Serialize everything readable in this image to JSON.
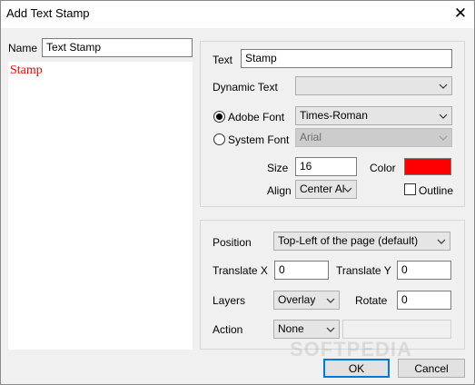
{
  "window": {
    "title": "Add Text Stamp"
  },
  "left": {
    "name_label": "Name",
    "name_value": "Text Stamp",
    "preview_text": "Stamp"
  },
  "text_group": {
    "text_label": "Text",
    "text_value": "Stamp",
    "dynamic_text_label": "Dynamic Text",
    "dynamic_text_value": "",
    "adobe_font_label": "Adobe Font",
    "adobe_font_value": "Times-Roman",
    "system_font_label": "System Font",
    "system_font_value": "Arial",
    "font_mode": "adobe",
    "size_label": "Size",
    "size_value": "16",
    "color_label": "Color",
    "color_value": "#ff0000",
    "align_label": "Align",
    "align_value": "Center Al",
    "outline_label": "Outline",
    "outline_checked": false
  },
  "position_group": {
    "position_label": "Position",
    "position_value": "Top-Left of the page (default)",
    "translate_x_label": "Translate X",
    "translate_x_value": "0",
    "translate_y_label": "Translate Y",
    "translate_y_value": "0",
    "layers_label": "Layers",
    "layers_value": "Overlay",
    "rotate_label": "Rotate",
    "rotate_value": "0",
    "action_label": "Action",
    "action_value": "None",
    "action_param_value": ""
  },
  "buttons": {
    "ok": "OK",
    "cancel": "Cancel"
  },
  "watermark": "SOFTPEDIA"
}
